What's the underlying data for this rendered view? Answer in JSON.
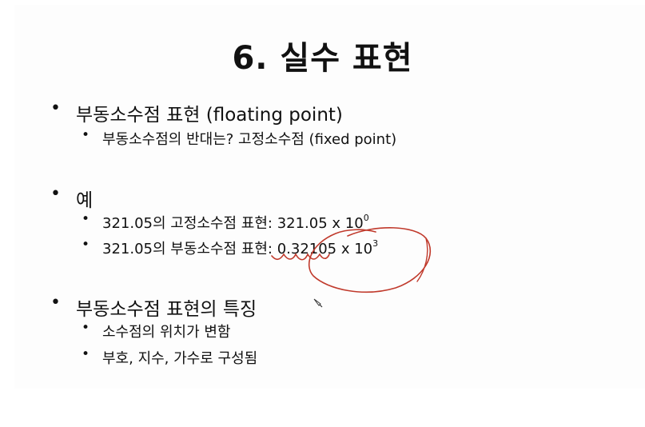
{
  "title": "6. 실수 표현",
  "sections": [
    {
      "heading": "부동소수점 표현 (floating point)",
      "items": [
        {
          "text": "부동소수점의 반대는? 고정소수점 (fixed point)"
        }
      ]
    },
    {
      "heading": "예",
      "items": [
        {
          "text": "321.05의 고정소수점 표현: 321.05 x 10",
          "sup": "0"
        },
        {
          "text": "321.05의 부동소수점 표현: 0.32105 x 10",
          "sup": "3"
        }
      ]
    },
    {
      "heading": "부동소수점 표현의 특징",
      "items": [
        {
          "text": "소수점의 위치가 변함"
        },
        {
          "text": "부호, 지수, 가수로 구성됨"
        }
      ]
    }
  ],
  "bullet": "•",
  "annotation_color": "#c0392b"
}
